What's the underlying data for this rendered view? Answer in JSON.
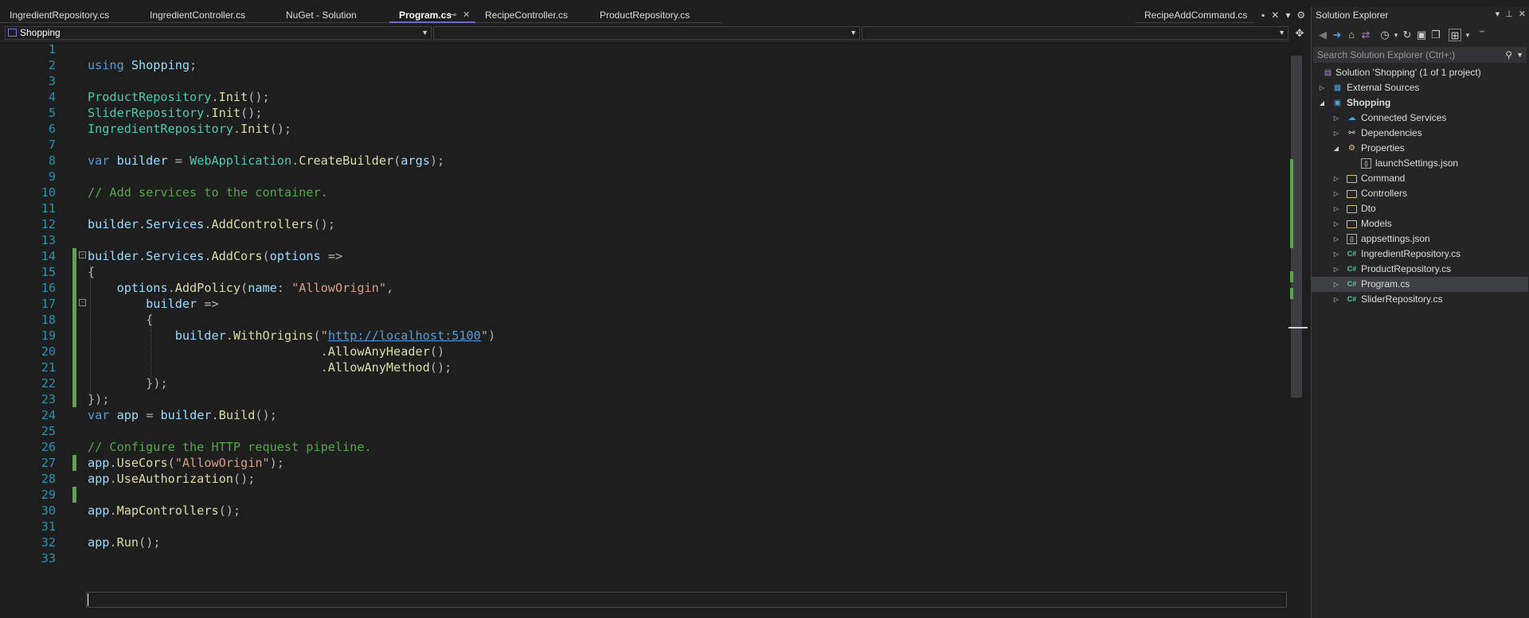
{
  "tabs": [
    {
      "label": "IngredientRepository.cs"
    },
    {
      "label": "IngredientController.cs"
    },
    {
      "label": "NuGet - Solution"
    },
    {
      "label": "Program.cs"
    },
    {
      "label": "RecipeController.cs"
    },
    {
      "label": "ProductRepository.cs"
    },
    {
      "label": "RecipeAddCommand.cs"
    }
  ],
  "navbar": {
    "project": "Shopping"
  },
  "code": {
    "line_numbers": [
      "1",
      "2",
      "3",
      "4",
      "5",
      "6",
      "7",
      "8",
      "9",
      "10",
      "11",
      "12",
      "13",
      "14",
      "15",
      "16",
      "17",
      "18",
      "19",
      "20",
      "21",
      "22",
      "23",
      "24",
      "25",
      "26",
      "27",
      "28",
      "29",
      "30",
      "31",
      "32",
      "33"
    ],
    "lines": [
      "",
      "using Shopping;",
      "",
      "ProductRepository.Init();",
      "SliderRepository.Init();",
      "IngredientRepository.Init();",
      "",
      "var builder = WebApplication.CreateBuilder(args);",
      "",
      "// Add services to the container.",
      "",
      "builder.Services.AddControllers();",
      "",
      "builder.Services.AddCors(options =>",
      "{",
      "    options.AddPolicy(name: \"AllowOrigin\",",
      "        builder =>",
      "        {",
      "            builder.WithOrigins(\"http://localhost:5100\")",
      "                                .AllowAnyHeader()",
      "                                .AllowAnyMethod();",
      "        });",
      "});",
      "var app = builder.Build();",
      "",
      "// Configure the HTTP request pipeline.",
      "app.UseCors(\"AllowOrigin\");",
      "app.UseAuthorization();",
      "",
      "app.MapControllers();",
      "",
      "app.Run();",
      ""
    ]
  },
  "solution_explorer": {
    "title": "Solution Explorer",
    "search_placeholder": "Search Solution Explorer (Ctrl+;)",
    "items": [
      {
        "label": "Solution 'Shopping' (1 of 1 project)"
      },
      {
        "label": "External Sources"
      },
      {
        "label": "Shopping"
      },
      {
        "label": "Connected Services"
      },
      {
        "label": "Dependencies"
      },
      {
        "label": "Properties"
      },
      {
        "label": "launchSettings.json"
      },
      {
        "label": "Command"
      },
      {
        "label": "Controllers"
      },
      {
        "label": "Dto"
      },
      {
        "label": "Models"
      },
      {
        "label": "appsettings.json"
      },
      {
        "label": "IngredientRepository.cs"
      },
      {
        "label": "ProductRepository.cs"
      },
      {
        "label": "Program.cs"
      },
      {
        "label": "SliderRepository.cs"
      }
    ]
  }
}
